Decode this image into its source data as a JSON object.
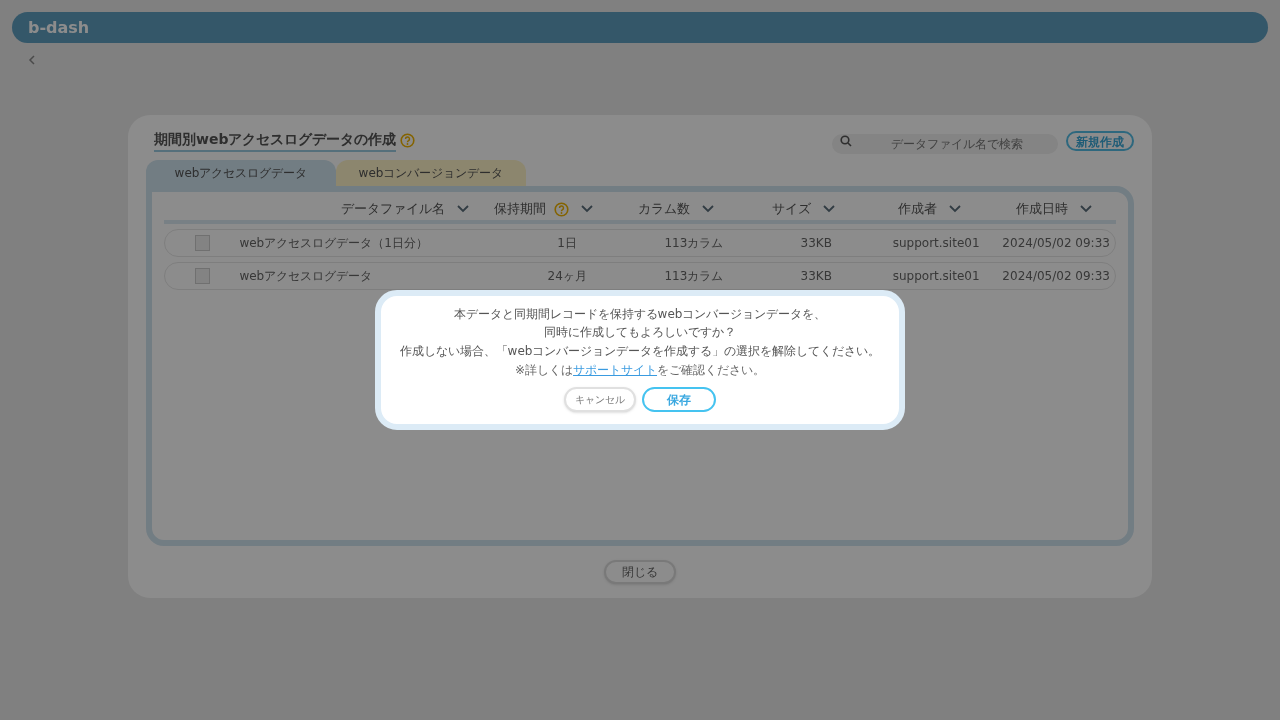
{
  "header": {
    "logo": "b-dash"
  },
  "panel": {
    "title": "期間別webアクセスログデータの作成",
    "search": {
      "placeholder": "データファイル名で検索"
    },
    "new_button": "新規作成",
    "tabs": [
      {
        "label": "webアクセスログデータ",
        "selected": true
      },
      {
        "label": "webコンバージョンデータ",
        "selected": false
      }
    ],
    "columns": [
      {
        "label": "データファイル名",
        "help": false
      },
      {
        "label": "保持期間",
        "help": true
      },
      {
        "label": "カラム数",
        "help": false
      },
      {
        "label": "サイズ",
        "help": false
      },
      {
        "label": "作成者",
        "help": false
      },
      {
        "label": "作成日時",
        "help": false
      }
    ],
    "rows": [
      {
        "checked": false,
        "cells": [
          "webアクセスログデータ（1日分）",
          "1日",
          "113カラム",
          "33KB",
          "support.site01",
          "2024/05/02 09:33"
        ]
      },
      {
        "checked": false,
        "cells": [
          "webアクセスログデータ",
          "24ヶ月",
          "113カラム",
          "33KB",
          "support.site01",
          "2024/05/02 09:33"
        ]
      }
    ],
    "close_button": "閉じる"
  },
  "dialog": {
    "message": [
      "本データと同期間レコードを保持するwebコンバージョンデータを、",
      "同時に作成してもよろしいですか？"
    ],
    "instruction": "作成しない場合、「webコンバージョンデータを作成する」の選択を解除してください。",
    "note": {
      "before": "※詳しくは",
      "link": "サポートサイト",
      "after": "をご確認ください。"
    },
    "buttons": [
      {
        "label": "キャンセル",
        "kind": "secondary"
      },
      {
        "label": "保存",
        "kind": "primary"
      }
    ]
  }
}
